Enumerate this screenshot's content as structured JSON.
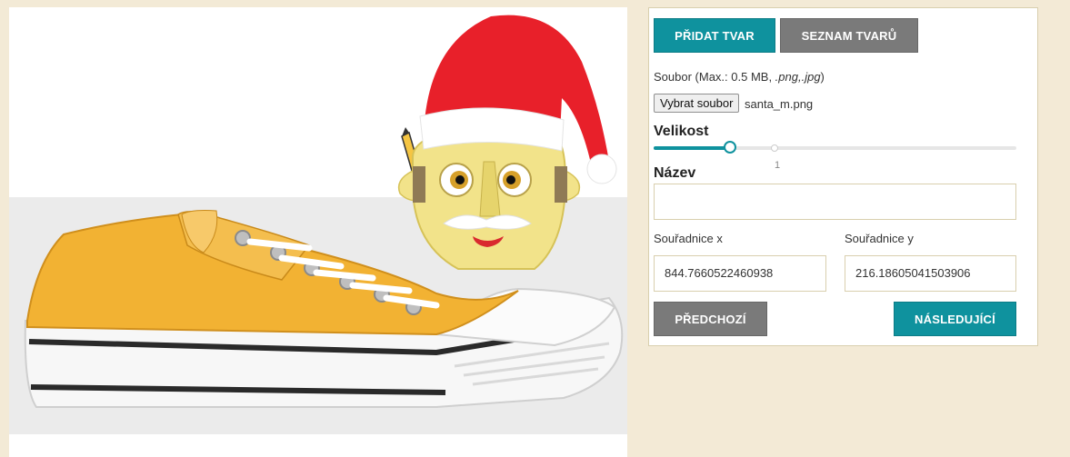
{
  "toolbar": {
    "add_shape_label": "PŘIDAT TVAR",
    "shape_list_label": "SEZNAM TVARŮ"
  },
  "file": {
    "hint_prefix": "Soubor (Max.: 0.5 MB, ",
    "hint_types": ".png,.jpg",
    "hint_suffix": ")",
    "choose_label": "Vybrat soubor",
    "selected_name": "santa_m.png"
  },
  "size": {
    "label": "Velikost",
    "tick_label": "1",
    "value_fraction": 0.21
  },
  "name": {
    "label": "Název",
    "value": ""
  },
  "coords": {
    "x_label": "Souřadnice x",
    "x_value": "844.7660522460938",
    "y_label": "Souřadnice y",
    "y_value": "216.18605041503906"
  },
  "nav": {
    "prev_label": "PŘEDCHOZÍ",
    "next_label": "NÁSLEDUJÍCÍ"
  },
  "colors": {
    "accent": "#0f929e",
    "secondary": "#7a7a7a",
    "page_bg": "#f3ead6",
    "border": "#d9cfae"
  },
  "canvas": {
    "images": [
      "yellow-sneaker",
      "santa-face-sticker"
    ]
  }
}
